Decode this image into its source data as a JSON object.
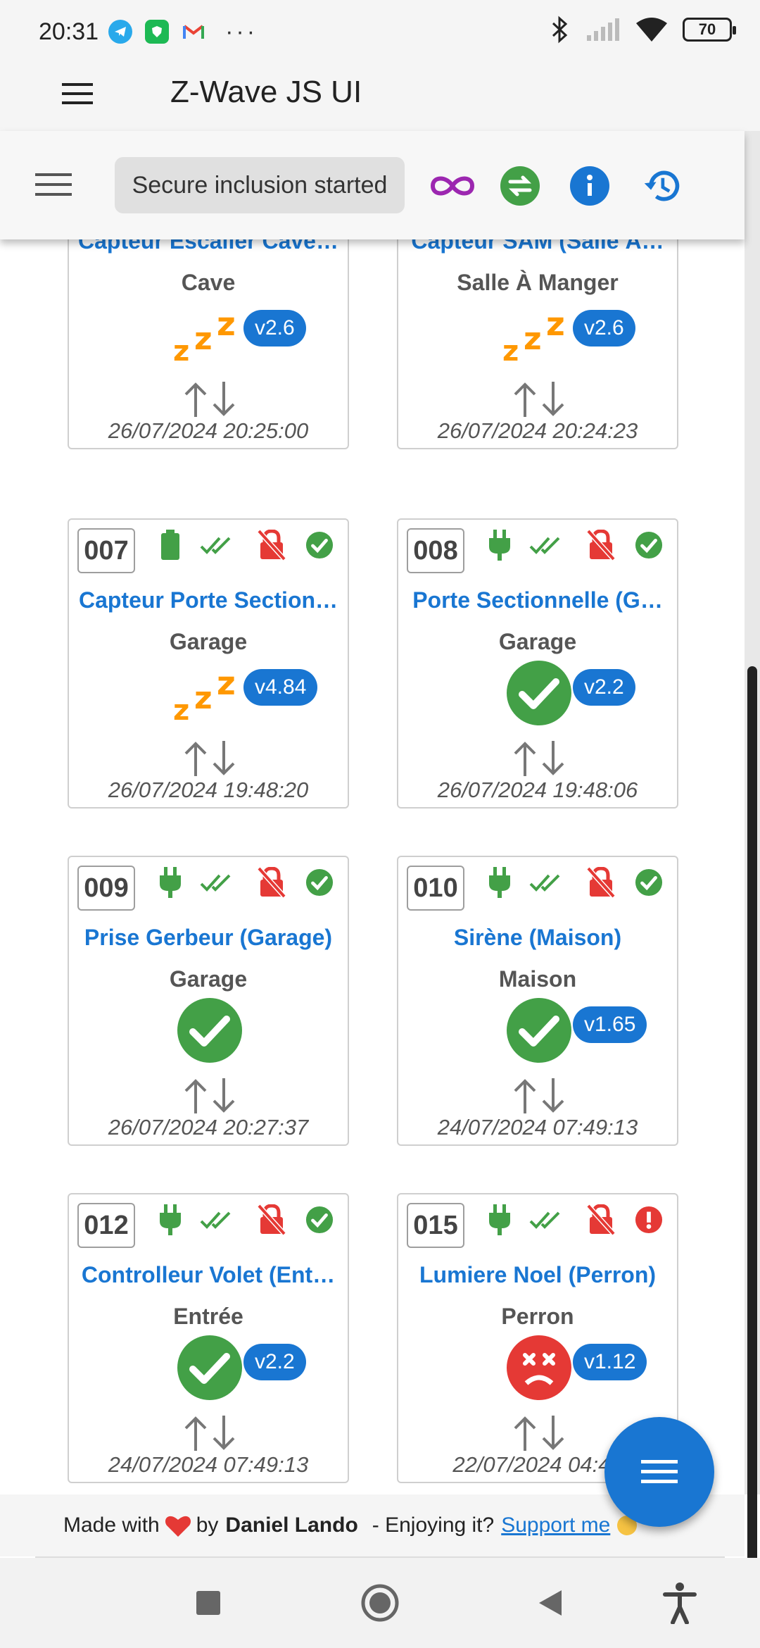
{
  "status_bar": {
    "time": "20:31",
    "dots": "···",
    "battery": "70"
  },
  "app": {
    "title": "Z-Wave JS UI"
  },
  "toolbar": {
    "chip_label": "Secure inclusion started"
  },
  "cards": [
    {
      "id": "",
      "name": "Capteur Escalier Cave…",
      "location": "Cave",
      "version": "v2.6",
      "state": "asleep",
      "date": "26/07/2024 20:25:00"
    },
    {
      "id": "",
      "name": "Capteur SAM (Salle À…",
      "location": "Salle À Manger",
      "version": "v2.6",
      "state": "asleep",
      "date": "26/07/2024 20:24:23"
    },
    {
      "id": "007",
      "name": "Capteur Porte Section…",
      "location": "Garage",
      "version": "v4.84",
      "state": "asleep",
      "power": "battery",
      "status": "ok",
      "date": "26/07/2024 19:48:20"
    },
    {
      "id": "008",
      "name": "Porte Sectionnelle (G…",
      "location": "Garage",
      "version": "v2.2",
      "state": "alive",
      "power": "mains",
      "status": "ok",
      "date": "26/07/2024 19:48:06"
    },
    {
      "id": "009",
      "name": "Prise Gerbeur (Garage)",
      "location": "Garage",
      "version": "",
      "state": "alive",
      "power": "mains",
      "status": "ok",
      "date": "26/07/2024 20:27:37"
    },
    {
      "id": "010",
      "name": "Sirène (Maison)",
      "location": "Maison",
      "version": "v1.65",
      "state": "alive",
      "power": "mains",
      "status": "ok",
      "date": "24/07/2024 07:49:13"
    },
    {
      "id": "012",
      "name": "Controlleur Volet (Ent…",
      "location": "Entrée",
      "version": "v2.2",
      "state": "alive",
      "power": "mains",
      "status": "ok",
      "date": "24/07/2024 07:49:13"
    },
    {
      "id": "015",
      "name": "Lumiere Noel (Perron)",
      "location": "Perron",
      "version": "v1.12",
      "state": "dead",
      "power": "mains",
      "status": "error",
      "date": "22/07/2024 04:48"
    }
  ],
  "footer": {
    "made_with": "Made with",
    "by": "by",
    "author": "Daniel Lando",
    "enjoying": "- Enjoying it?",
    "support": "Support me"
  },
  "colors": {
    "primary": "#1976d2",
    "green": "#43a047",
    "red": "#e53935",
    "orange": "#ff9800",
    "purple": "#9c27b0"
  }
}
